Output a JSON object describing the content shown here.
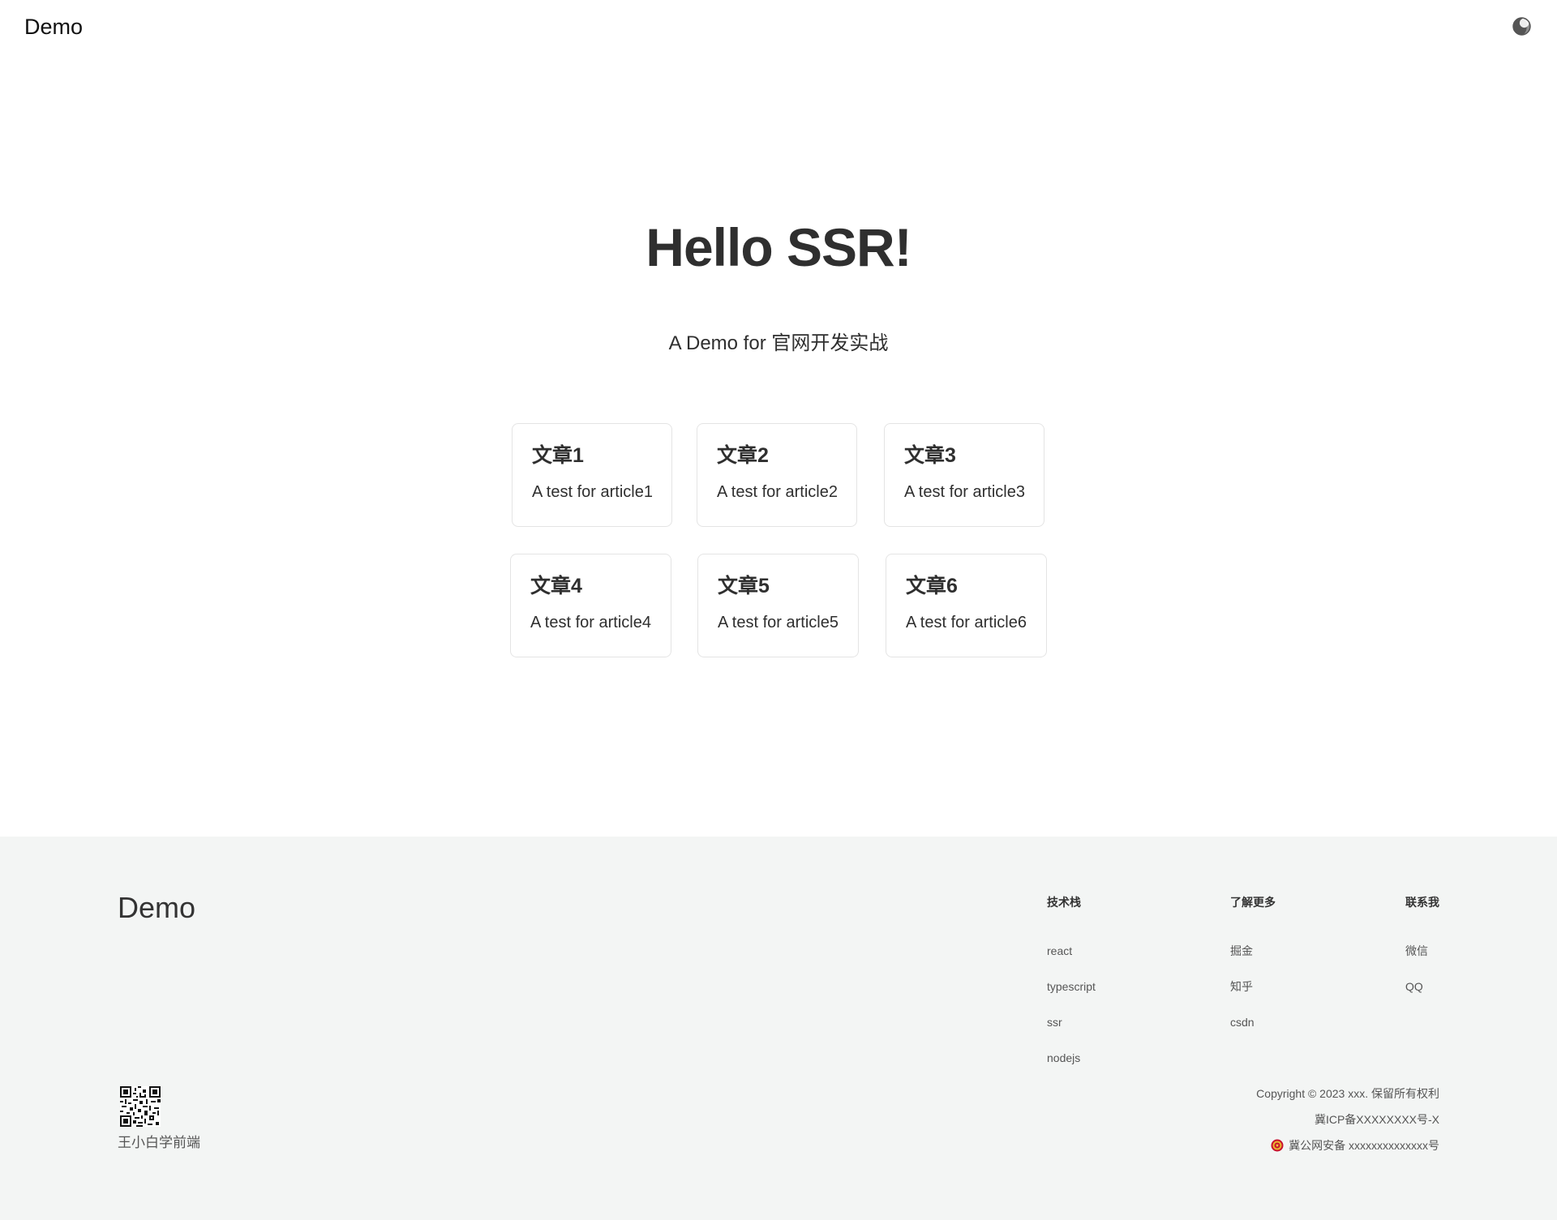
{
  "header": {
    "brand": "Demo",
    "theme_toggle_icon": "moon-half-icon"
  },
  "hero": {
    "title": "Hello SSR!",
    "subtitle": "A Demo for 官网开发实战"
  },
  "articles": [
    {
      "title": "文章1",
      "desc": "A test for article1"
    },
    {
      "title": "文章2",
      "desc": "A test for article2"
    },
    {
      "title": "文章3",
      "desc": "A test for article3"
    },
    {
      "title": "文章4",
      "desc": "A test for article4"
    },
    {
      "title": "文章5",
      "desc": "A test for article5"
    },
    {
      "title": "文章6",
      "desc": "A test for article6"
    }
  ],
  "footer": {
    "brand": "Demo",
    "columns": [
      {
        "title": "技术栈",
        "links": [
          "react",
          "typescript",
          "ssr",
          "nodejs"
        ]
      },
      {
        "title": "了解更多",
        "links": [
          "掘金",
          "知乎",
          "csdn"
        ]
      },
      {
        "title": "联系我",
        "links": [
          "微信",
          "QQ"
        ]
      }
    ],
    "qr_label": "王小白学前端",
    "copyright": "Copyright © 2023 xxx. 保留所有权利",
    "icp": "冀ICP备XXXXXXXX号-X",
    "police": "冀公网安备 xxxxxxxxxxxxxx号"
  },
  "colors": {
    "text": "#2f2f2f",
    "footer_bg": "#f3f5f4",
    "card_border": "#e4e4e4"
  }
}
